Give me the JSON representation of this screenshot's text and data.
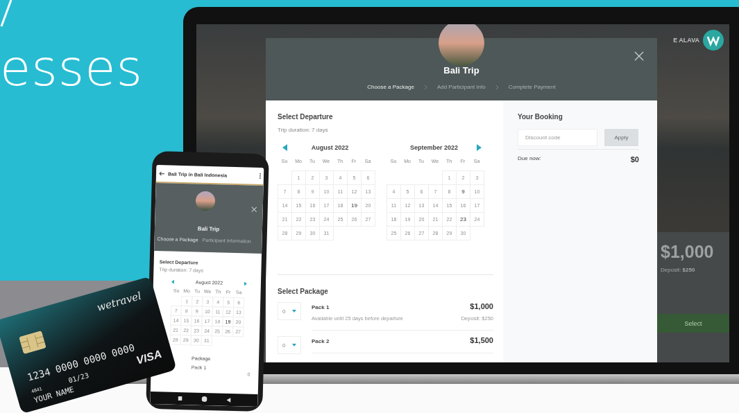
{
  "headline": {
    "text": "esses"
  },
  "laptop": {
    "site": {
      "brand": "E ALAVA",
      "price": "$1,000",
      "deposit": "Deposit: **$250**",
      "button": "Select"
    },
    "modal": {
      "title": "Bali Trip",
      "steps": [
        {
          "label": "Choose a Package",
          "selected": true
        },
        {
          "label": "Add Participant Info",
          "selected": false
        },
        {
          "label": "Complete Payment",
          "selected": false
        }
      ],
      "departure": {
        "title": "Select Departure",
        "duration": "Trip duration: 7 days",
        "months": [
          {
            "name": "August 2022",
            "kind": "prev",
            "weekdays": [
              "Su",
              "Mo",
              "Tu",
              "We",
              "Th",
              "Fr",
              "Sa"
            ],
            "days": [
              {
                "kind": "blank"
              },
              {
                "kind": "day",
                "d": "1",
                "available": false
              },
              {
                "kind": "day",
                "d": "2",
                "available": false
              },
              {
                "kind": "day",
                "d": "3",
                "available": false
              },
              {
                "kind": "day",
                "d": "4",
                "available": false
              },
              {
                "kind": "day",
                "d": "5",
                "available": false
              },
              {
                "kind": "day",
                "d": "6",
                "available": false
              },
              {
                "kind": "day",
                "d": "7",
                "available": false
              },
              {
                "kind": "day",
                "d": "8",
                "available": false
              },
              {
                "kind": "day",
                "d": "9",
                "available": false
              },
              {
                "kind": "day",
                "d": "10",
                "available": false
              },
              {
                "kind": "day",
                "d": "11",
                "available": false
              },
              {
                "kind": "day",
                "d": "12",
                "available": false
              },
              {
                "kind": "day",
                "d": "13",
                "available": false
              },
              {
                "kind": "day",
                "d": "14",
                "available": false
              },
              {
                "kind": "day",
                "d": "15",
                "available": false
              },
              {
                "kind": "day",
                "d": "16",
                "available": false
              },
              {
                "kind": "day",
                "d": "17",
                "available": false
              },
              {
                "kind": "day",
                "d": "18",
                "available": false
              },
              {
                "kind": "day",
                "d": "19",
                "available": true
              },
              {
                "kind": "day",
                "d": "20",
                "available": false
              },
              {
                "kind": "day",
                "d": "21",
                "available": false
              },
              {
                "kind": "day",
                "d": "22",
                "available": false
              },
              {
                "kind": "day",
                "d": "23",
                "available": false
              },
              {
                "kind": "day",
                "d": "24",
                "available": false
              },
              {
                "kind": "day",
                "d": "25",
                "available": false
              },
              {
                "kind": "day",
                "d": "26",
                "available": false
              },
              {
                "kind": "day",
                "d": "27",
                "available": false
              },
              {
                "kind": "day",
                "d": "28",
                "available": false
              },
              {
                "kind": "day",
                "d": "29",
                "available": false
              },
              {
                "kind": "day",
                "d": "30",
                "available": false
              },
              {
                "kind": "day",
                "d": "31",
                "available": false
              }
            ]
          },
          {
            "name": "September 2022",
            "kind": "next",
            "weekdays": [
              "Su",
              "Mo",
              "Tu",
              "We",
              "Th",
              "Fr",
              "Sa"
            ],
            "days": [
              {
                "kind": "blank"
              },
              {
                "kind": "blank"
              },
              {
                "kind": "blank"
              },
              {
                "kind": "blank"
              },
              {
                "kind": "day",
                "d": "1",
                "available": false
              },
              {
                "kind": "day",
                "d": "2",
                "available": false
              },
              {
                "kind": "day",
                "d": "3",
                "available": false
              },
              {
                "kind": "day",
                "d": "4",
                "available": false
              },
              {
                "kind": "day",
                "d": "5",
                "available": false
              },
              {
                "kind": "day",
                "d": "6",
                "available": false
              },
              {
                "kind": "day",
                "d": "7",
                "available": false
              },
              {
                "kind": "day",
                "d": "8",
                "available": false
              },
              {
                "kind": "day",
                "d": "9",
                "available": true
              },
              {
                "kind": "day",
                "d": "10",
                "available": false
              },
              {
                "kind": "day",
                "d": "11",
                "available": false
              },
              {
                "kind": "day",
                "d": "12",
                "available": false
              },
              {
                "kind": "day",
                "d": "13",
                "available": false
              },
              {
                "kind": "day",
                "d": "14",
                "available": false
              },
              {
                "kind": "day",
                "d": "15",
                "available": false
              },
              {
                "kind": "day",
                "d": "16",
                "available": false
              },
              {
                "kind": "day",
                "d": "17",
                "available": false
              },
              {
                "kind": "day",
                "d": "18",
                "available": false
              },
              {
                "kind": "day",
                "d": "19",
                "available": false
              },
              {
                "kind": "day",
                "d": "20",
                "available": false
              },
              {
                "kind": "day",
                "d": "21",
                "available": false
              },
              {
                "kind": "day",
                "d": "22",
                "available": false
              },
              {
                "kind": "day",
                "d": "23",
                "available": true
              },
              {
                "kind": "day",
                "d": "24",
                "available": false
              },
              {
                "kind": "day",
                "d": "25",
                "available": false
              },
              {
                "kind": "day",
                "d": "26",
                "available": false
              },
              {
                "kind": "day",
                "d": "27",
                "available": false
              },
              {
                "kind": "day",
                "d": "28",
                "available": false
              },
              {
                "kind": "day",
                "d": "29",
                "available": false
              },
              {
                "kind": "day",
                "d": "30",
                "available": false
              }
            ]
          }
        ]
      },
      "package": {
        "title": "Select Package",
        "items": [
          {
            "qty": "0",
            "name": "Pack 1",
            "note": "Available until 25 days before departure",
            "price": "$1,000",
            "deposit": "Deposit: $250"
          },
          {
            "qty": "0",
            "name": "Pack 2",
            "price": "$1,500"
          }
        ]
      },
      "booking": {
        "title": "Your Booking",
        "discount": {
          "placeholder": "Discount code"
        },
        "apply": "Apply",
        "due_label": "Due now:",
        "due": "$0"
      }
    }
  },
  "phone": {
    "browser_title": "Bali Trip in Bali Indonesia",
    "title": "Bali Trip",
    "steps": [
      {
        "label": "Choose a Package",
        "selected": true
      },
      {
        "label": "Participant Information",
        "selected": false
      }
    ],
    "departure_title": "Select Departure",
    "duration": "Trip duration: 7 days",
    "month": {
      "name": "August 2022",
      "weekdays": [
        "Su",
        "Mo",
        "Tu",
        "We",
        "Th",
        "Fr",
        "Sa"
      ],
      "days": [
        {
          "kind": "blank"
        },
        {
          "kind": "day",
          "d": "1",
          "available": false
        },
        {
          "kind": "day",
          "d": "2",
          "available": false
        },
        {
          "kind": "day",
          "d": "3",
          "available": false
        },
        {
          "kind": "day",
          "d": "4",
          "available": false
        },
        {
          "kind": "day",
          "d": "5",
          "available": false
        },
        {
          "kind": "day",
          "d": "6",
          "available": false
        },
        {
          "kind": "day",
          "d": "7",
          "available": false
        },
        {
          "kind": "day",
          "d": "8",
          "available": false
        },
        {
          "kind": "day",
          "d": "9",
          "available": false
        },
        {
          "kind": "day",
          "d": "10",
          "available": false
        },
        {
          "kind": "day",
          "d": "11",
          "available": false
        },
        {
          "kind": "day",
          "d": "12",
          "available": false
        },
        {
          "kind": "day",
          "d": "13",
          "available": false
        },
        {
          "kind": "day",
          "d": "14",
          "available": false
        },
        {
          "kind": "day",
          "d": "15",
          "available": false
        },
        {
          "kind": "day",
          "d": "16",
          "available": false
        },
        {
          "kind": "day",
          "d": "17",
          "available": false
        },
        {
          "kind": "day",
          "d": "18",
          "available": false
        },
        {
          "kind": "day",
          "d": "19",
          "available": true
        },
        {
          "kind": "day",
          "d": "20",
          "available": false
        },
        {
          "kind": "day",
          "d": "21",
          "available": false
        },
        {
          "kind": "day",
          "d": "22",
          "available": false
        },
        {
          "kind": "day",
          "d": "23",
          "available": false
        },
        {
          "kind": "day",
          "d": "24",
          "available": false
        },
        {
          "kind": "day",
          "d": "25",
          "available": false
        },
        {
          "kind": "day",
          "d": "26",
          "available": false
        },
        {
          "kind": "day",
          "d": "27",
          "available": false
        },
        {
          "kind": "day",
          "d": "28",
          "available": false
        },
        {
          "kind": "day",
          "d": "29",
          "available": false
        },
        {
          "kind": "day",
          "d": "30",
          "available": false
        },
        {
          "kind": "day",
          "d": "31",
          "available": false
        }
      ]
    },
    "package_title": "Package",
    "pack": "Pack 1",
    "qty": "0"
  },
  "card": {
    "brand": "wetravel",
    "number": "1234 0000 0000 0000",
    "small": "4841",
    "expiry": "01/23",
    "network": "VISA",
    "name": "YOUR NAME"
  }
}
